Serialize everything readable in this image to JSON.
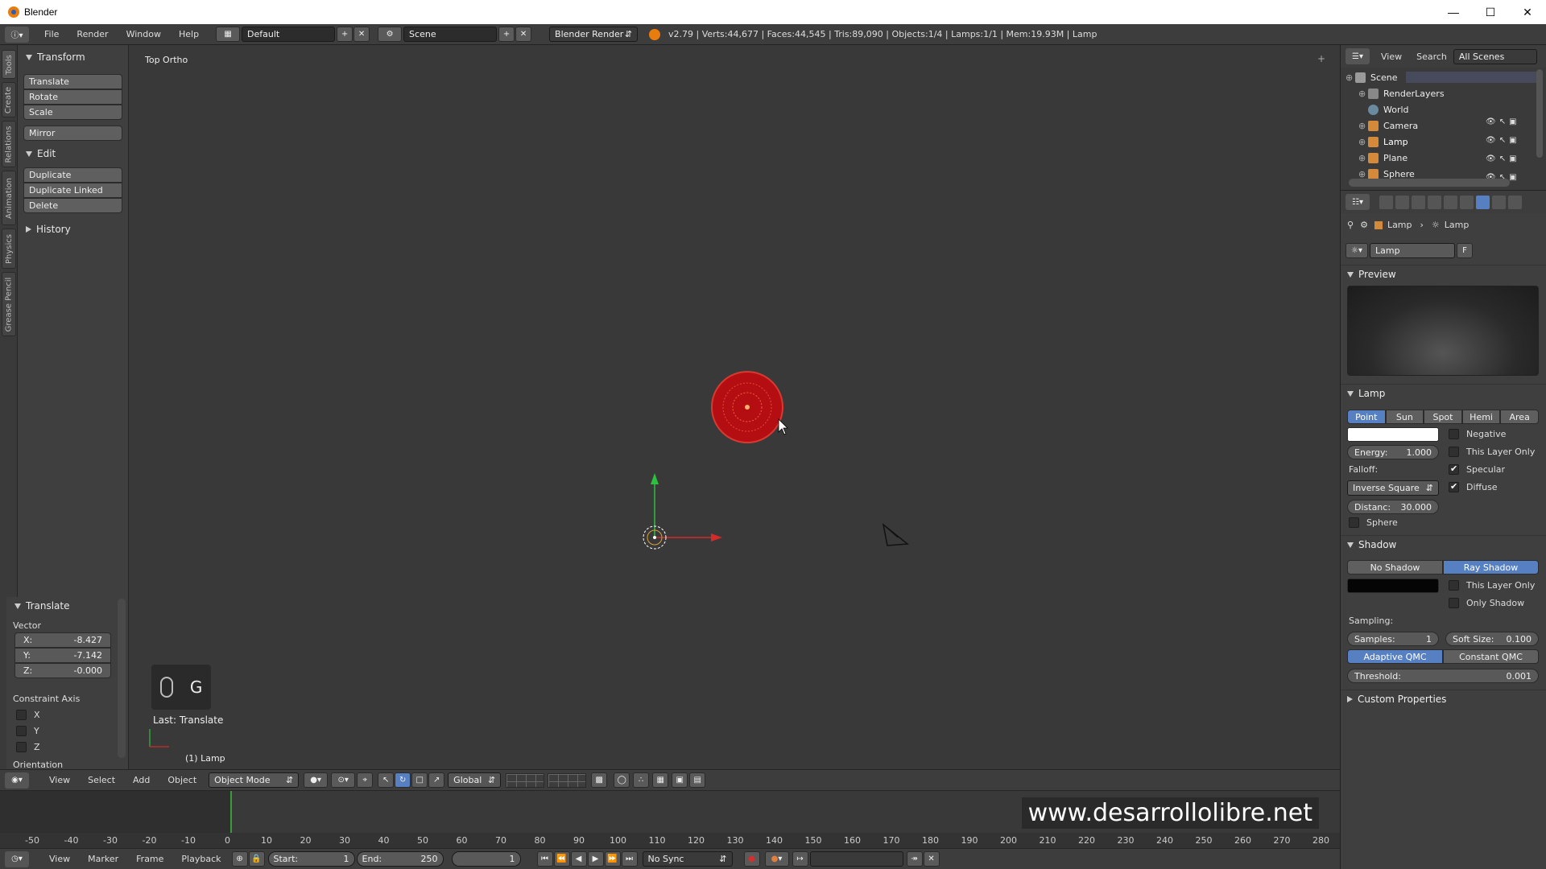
{
  "window": {
    "title": "Blender"
  },
  "info": {
    "menus": [
      "File",
      "Render",
      "Window",
      "Help"
    ],
    "layout": "Default",
    "scene": "Scene",
    "engine": "Blender Render",
    "stats": "v2.79 | Verts:44,677 | Faces:44,545 | Tris:89,090 | Objects:1/4 | Lamps:1/1 | Mem:19.93M | Lamp"
  },
  "tabs": [
    "Tools",
    "Create",
    "Relations",
    "Animation",
    "Physics",
    "Grease Pencil"
  ],
  "toolshelf": {
    "transform": {
      "title": "Transform",
      "buttons": [
        "Translate",
        "Rotate",
        "Scale"
      ],
      "mirror": "Mirror"
    },
    "edit": {
      "title": "Edit",
      "buttons": [
        "Duplicate",
        "Duplicate Linked",
        "Delete"
      ]
    },
    "history": {
      "title": "History"
    }
  },
  "operator": {
    "title": "Translate",
    "vector_label": "Vector",
    "x": {
      "label": "X:",
      "value": "-8.427"
    },
    "y": {
      "label": "Y:",
      "value": "-7.142"
    },
    "z": {
      "label": "Z:",
      "value": "-0.000"
    },
    "constraint_label": "Constraint Axis",
    "axes": [
      "X",
      "Y",
      "Z"
    ],
    "orientation_label": "Orientation"
  },
  "viewport": {
    "view_name": "Top Ortho",
    "key_hint": "G",
    "last_op": "Last: Translate",
    "active_object": "(1) Lamp",
    "watermark": "www.desarrollolibre.net"
  },
  "v3dheader": {
    "menus": [
      "View",
      "Select",
      "Add",
      "Object"
    ],
    "mode": "Object Mode",
    "orientation": "Global"
  },
  "timeline": {
    "ticks": [
      "-50",
      "-40",
      "-30",
      "-20",
      "-10",
      "0",
      "10",
      "20",
      "30",
      "40",
      "50",
      "60",
      "70",
      "80",
      "90",
      "100",
      "110",
      "120",
      "130",
      "140",
      "150",
      "160",
      "170",
      "180",
      "190",
      "200",
      "210",
      "220",
      "230",
      "240",
      "250",
      "260",
      "270",
      "280"
    ],
    "menus": [
      "View",
      "Marker",
      "Frame",
      "Playback"
    ],
    "start": {
      "label": "Start:",
      "value": "1"
    },
    "end": {
      "label": "End:",
      "value": "250"
    },
    "current": "1",
    "sync": "No Sync"
  },
  "outliner": {
    "menus": [
      "View",
      "Search"
    ],
    "filter": "All Scenes",
    "items": [
      "Scene",
      "RenderLayers",
      "World",
      "Camera",
      "Lamp",
      "Plane",
      "Sphere"
    ]
  },
  "properties": {
    "breadcrumb": [
      "Lamp",
      "Lamp"
    ],
    "datablock": "Lamp",
    "fake_user": "F",
    "preview_title": "Preview",
    "lamp_title": "Lamp",
    "lamp_types": [
      "Point",
      "Sun",
      "Spot",
      "Hemi",
      "Area"
    ],
    "negative": "Negative",
    "this_layer_only": "This Layer Only",
    "specular": "Specular",
    "diffuse": "Diffuse",
    "energy": {
      "label": "Energy:",
      "value": "1.000"
    },
    "falloff_label": "Falloff:",
    "falloff": "Inverse Square",
    "distance": {
      "label": "Distanc:",
      "value": "30.000"
    },
    "sphere": "Sphere",
    "shadow_title": "Shadow",
    "shadow_types": [
      "No Shadow",
      "Ray Shadow"
    ],
    "shadow_layer": "This Layer Only",
    "only_shadow": "Only Shadow",
    "sampling_label": "Sampling:",
    "samples": {
      "label": "Samples:",
      "value": "1"
    },
    "soft_size": {
      "label": "Soft Size:",
      "value": "0.100"
    },
    "qmc": [
      "Adaptive QMC",
      "Constant QMC"
    ],
    "threshold": {
      "label": "Threshold:",
      "value": "0.001"
    },
    "custom_props": "Custom Properties"
  }
}
